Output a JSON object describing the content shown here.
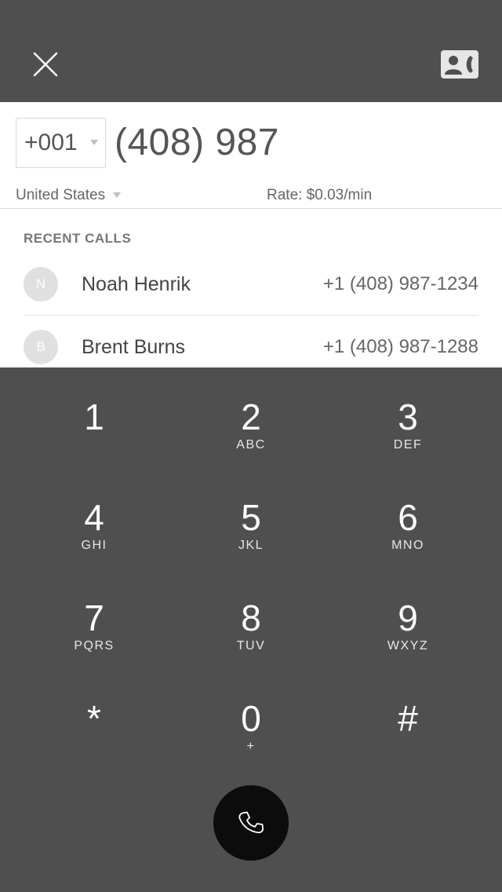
{
  "icons": {
    "close": "close-icon",
    "contacts": "contacts-call-icon",
    "phone": "phone-icon"
  },
  "colors": {
    "chrome": "#4f4f4f",
    "panel": "#ffffff",
    "call_button": "#0c0c0c"
  },
  "dial": {
    "country_code": "+001",
    "number": "(408) 987",
    "country": "United States",
    "rate": "Rate: $0.03/min"
  },
  "recent": {
    "heading": "RECENT CALLS",
    "calls": [
      {
        "initial": "N",
        "name": "Noah Henrik",
        "number": "+1 (408) 987-1234"
      },
      {
        "initial": "B",
        "name": "Brent Burns",
        "number": "+1 (408) 987-1288"
      }
    ]
  },
  "keypad": [
    {
      "digit": "1",
      "letters": ""
    },
    {
      "digit": "2",
      "letters": "ABC"
    },
    {
      "digit": "3",
      "letters": "DEF"
    },
    {
      "digit": "4",
      "letters": "GHI"
    },
    {
      "digit": "5",
      "letters": "JKL"
    },
    {
      "digit": "6",
      "letters": "MNO"
    },
    {
      "digit": "7",
      "letters": "PQRS"
    },
    {
      "digit": "8",
      "letters": "TUV"
    },
    {
      "digit": "9",
      "letters": "WXYZ"
    },
    {
      "digit": "*",
      "letters": ""
    },
    {
      "digit": "0",
      "letters": "+"
    },
    {
      "digit": "#",
      "letters": ""
    }
  ]
}
